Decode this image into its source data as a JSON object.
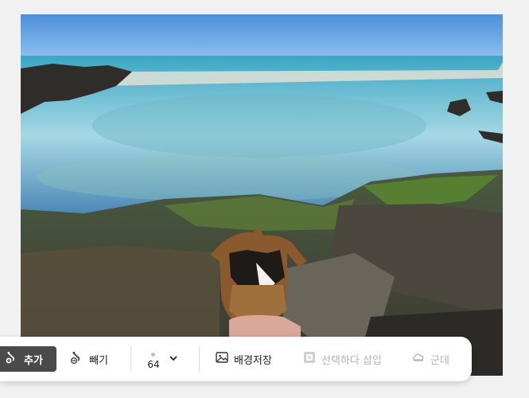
{
  "toolbar": {
    "add_label": "추가",
    "subtract_label": "빼기",
    "brush_size": "64",
    "save_bg_label": "배경저장",
    "select_insert_label": "선택하다 삽입",
    "group_label": "군데"
  },
  "icons": {
    "add": "brush-plus-icon",
    "subtract": "brush-minus-icon",
    "brush_dropdown": "chevron-down-icon",
    "save_bg": "image-icon",
    "select_insert": "select-insert-icon",
    "group": "undo-cloud-icon"
  },
  "colors": {
    "active_button": "#4a4a4a",
    "disabled_text": "#b3b3b3",
    "toolbar_bg": "#ffffff"
  }
}
